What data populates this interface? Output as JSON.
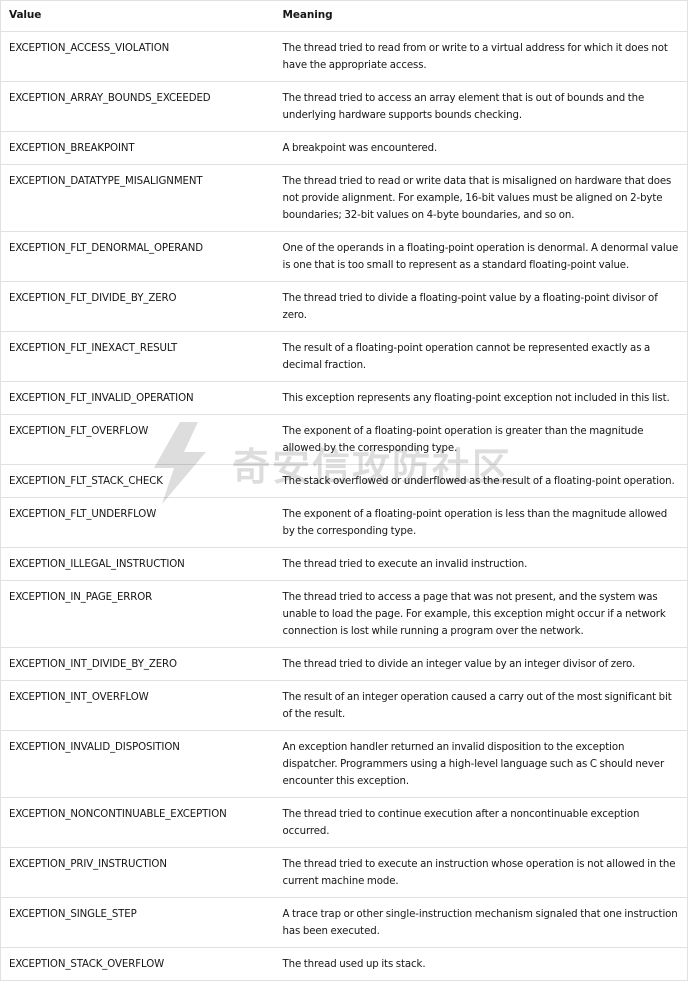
{
  "table": {
    "headers": [
      "Value",
      "Meaning"
    ],
    "rows": [
      {
        "value": "EXCEPTION_ACCESS_VIOLATION",
        "meaning": "The thread tried to read from or write to a virtual address for which it does not have the appropriate access."
      },
      {
        "value": "EXCEPTION_ARRAY_BOUNDS_EXCEEDED",
        "meaning": "The thread tried to access an array element that is out of bounds and the underlying hardware supports bounds checking."
      },
      {
        "value": "EXCEPTION_BREAKPOINT",
        "meaning": "A breakpoint was encountered."
      },
      {
        "value": "EXCEPTION_DATATYPE_MISALIGNMENT",
        "meaning": "The thread tried to read or write data that is misaligned on hardware that does not provide alignment. For example, 16-bit values must be aligned on 2-byte boundaries; 32-bit values on 4-byte boundaries, and so on."
      },
      {
        "value": "EXCEPTION_FLT_DENORMAL_OPERAND",
        "meaning": "One of the operands in a floating-point operation is denormal. A denormal value is one that is too small to represent as a standard floating-point value."
      },
      {
        "value": "EXCEPTION_FLT_DIVIDE_BY_ZERO",
        "meaning": "The thread tried to divide a floating-point value by a floating-point divisor of zero."
      },
      {
        "value": "EXCEPTION_FLT_INEXACT_RESULT",
        "meaning": "The result of a floating-point operation cannot be represented exactly as a decimal fraction."
      },
      {
        "value": "EXCEPTION_FLT_INVALID_OPERATION",
        "meaning": "This exception represents any floating-point exception not included in this list."
      },
      {
        "value": "EXCEPTION_FLT_OVERFLOW",
        "meaning": "The exponent of a floating-point operation is greater than the magnitude allowed by the corresponding type."
      },
      {
        "value": "EXCEPTION_FLT_STACK_CHECK",
        "meaning": "The stack overflowed or underflowed as the result of a floating-point operation."
      },
      {
        "value": "EXCEPTION_FLT_UNDERFLOW",
        "meaning": "The exponent of a floating-point operation is less than the magnitude allowed by the corresponding type."
      },
      {
        "value": "EXCEPTION_ILLEGAL_INSTRUCTION",
        "meaning": "The thread tried to execute an invalid instruction."
      },
      {
        "value": "EXCEPTION_IN_PAGE_ERROR",
        "meaning": "The thread tried to access a page that was not present, and the system was unable to load the page. For example, this exception might occur if a network connection is lost while running a program over the network."
      },
      {
        "value": "EXCEPTION_INT_DIVIDE_BY_ZERO",
        "meaning": "The thread tried to divide an integer value by an integer divisor of zero."
      },
      {
        "value": "EXCEPTION_INT_OVERFLOW",
        "meaning": "The result of an integer operation caused a carry out of the most significant bit of the result."
      },
      {
        "value": "EXCEPTION_INVALID_DISPOSITION",
        "meaning": "An exception handler returned an invalid disposition to the exception dispatcher. Programmers using a high-level language such as C should never encounter this exception."
      },
      {
        "value": "EXCEPTION_NONCONTINUABLE_EXCEPTION",
        "meaning": "The thread tried to continue execution after a noncontinuable exception occurred."
      },
      {
        "value": "EXCEPTION_PRIV_INSTRUCTION",
        "meaning": "The thread tried to execute an instruction whose operation is not allowed in the current machine mode."
      },
      {
        "value": "EXCEPTION_SINGLE_STEP",
        "meaning": "A trace trap or other single-instruction mechanism signaled that one instruction has been executed."
      },
      {
        "value": "EXCEPTION_STACK_OVERFLOW",
        "meaning": "The thread used up its stack."
      }
    ]
  },
  "watermark": {
    "text": "奇安信攻防社区",
    "icon": "lightning-bolt-icon"
  }
}
